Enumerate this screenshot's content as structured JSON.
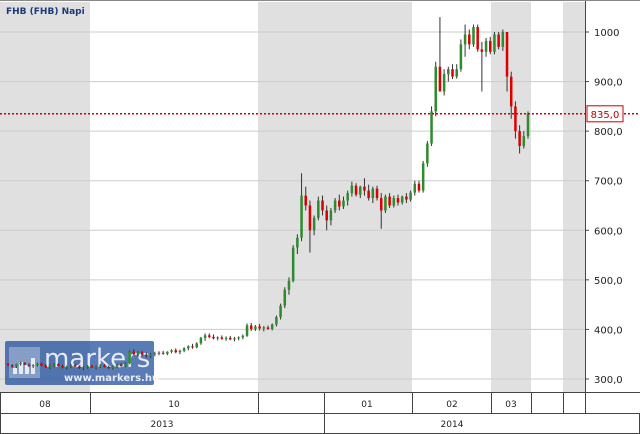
{
  "chart_data": {
    "type": "candlestick",
    "title": "FHB (FHB)  Napi",
    "ylim": [
      270,
      1060
    ],
    "yticks": [
      300,
      400,
      500,
      600,
      700,
      800,
      900,
      1000
    ],
    "ytick_labels": [
      "300,0",
      "400,0",
      "500,0",
      "600,0",
      "700,0",
      "800,0",
      "900,0",
      "1000"
    ],
    "grid": true,
    "last_price": 835,
    "last_price_label": "835,0",
    "colors": {
      "up": "#2e8b2e",
      "down": "#dd0000",
      "wick": "#333333",
      "price_line": "#cc0000",
      "shade": "#e0e0e0",
      "grid": "#cccccc"
    },
    "x_months": [
      "08",
      "10",
      "01",
      "02",
      "03"
    ],
    "x_years": [
      "2013",
      "2014"
    ],
    "watermark": {
      "brand": "markers",
      "url": "www.markers.hu",
      "brand_color": "#1a4a9a"
    },
    "candles": [
      [
        330,
        332,
        326,
        328
      ],
      [
        328,
        330,
        322,
        325
      ],
      [
        325,
        331,
        322,
        330
      ],
      [
        330,
        335,
        327,
        333
      ],
      [
        333,
        334,
        328,
        329
      ],
      [
        329,
        332,
        324,
        326
      ],
      [
        326,
        330,
        322,
        328
      ],
      [
        328,
        333,
        325,
        331
      ],
      [
        331,
        333,
        326,
        327
      ],
      [
        327,
        330,
        322,
        324
      ],
      [
        324,
        329,
        320,
        327
      ],
      [
        327,
        332,
        324,
        330
      ],
      [
        330,
        332,
        325,
        326
      ],
      [
        326,
        329,
        321,
        323
      ],
      [
        323,
        327,
        319,
        325
      ],
      [
        325,
        330,
        322,
        328
      ],
      [
        328,
        331,
        324,
        325
      ],
      [
        325,
        328,
        320,
        322
      ],
      [
        322,
        326,
        318,
        324
      ],
      [
        324,
        328,
        321,
        326
      ],
      [
        326,
        329,
        322,
        323
      ],
      [
        323,
        327,
        319,
        325
      ],
      [
        325,
        330,
        322,
        327
      ],
      [
        327,
        330,
        323,
        324
      ],
      [
        324,
        327,
        320,
        322
      ],
      [
        322,
        327,
        319,
        325
      ],
      [
        325,
        331,
        322,
        329
      ],
      [
        329,
        332,
        325,
        326
      ],
      [
        326,
        334,
        324,
        332
      ],
      [
        332,
        358,
        330,
        355
      ],
      [
        355,
        360,
        348,
        350
      ],
      [
        350,
        356,
        345,
        354
      ],
      [
        354,
        357,
        347,
        349
      ],
      [
        349,
        353,
        343,
        346
      ],
      [
        346,
        352,
        342,
        350
      ],
      [
        350,
        355,
        346,
        352
      ],
      [
        352,
        356,
        348,
        353
      ],
      [
        353,
        357,
        349,
        351
      ],
      [
        351,
        356,
        348,
        355
      ],
      [
        355,
        360,
        352,
        358
      ],
      [
        358,
        362,
        352,
        354
      ],
      [
        354,
        359,
        350,
        357
      ],
      [
        357,
        364,
        354,
        362
      ],
      [
        362,
        368,
        358,
        366
      ],
      [
        366,
        371,
        361,
        364
      ],
      [
        364,
        374,
        362,
        372
      ],
      [
        372,
        385,
        369,
        383
      ],
      [
        383,
        392,
        377,
        388
      ],
      [
        388,
        392,
        382,
        385
      ],
      [
        385,
        390,
        380,
        382
      ],
      [
        382,
        386,
        378,
        384
      ],
      [
        384,
        388,
        379,
        381
      ],
      [
        381,
        386,
        377,
        383
      ],
      [
        383,
        387,
        378,
        380
      ],
      [
        380,
        385,
        376,
        382
      ],
      [
        382,
        386,
        378,
        384
      ],
      [
        384,
        390,
        380,
        387
      ],
      [
        387,
        412,
        385,
        408
      ],
      [
        408,
        413,
        397,
        401
      ],
      [
        401,
        409,
        397,
        406
      ],
      [
        406,
        411,
        398,
        402
      ],
      [
        402,
        407,
        396,
        404
      ],
      [
        404,
        408,
        399,
        401
      ],
      [
        401,
        412,
        398,
        410
      ],
      [
        410,
        428,
        406,
        425
      ],
      [
        425,
        452,
        420,
        448
      ],
      [
        448,
        485,
        443,
        480
      ],
      [
        480,
        505,
        470,
        498
      ],
      [
        498,
        570,
        495,
        565
      ],
      [
        565,
        592,
        552,
        585
      ],
      [
        585,
        715,
        578,
        670
      ],
      [
        670,
        688,
        640,
        650
      ],
      [
        650,
        660,
        555,
        600
      ],
      [
        600,
        630,
        590,
        625
      ],
      [
        625,
        668,
        620,
        660
      ],
      [
        660,
        670,
        630,
        640
      ],
      [
        640,
        650,
        600,
        620
      ],
      [
        620,
        645,
        610,
        640
      ],
      [
        640,
        665,
        635,
        660
      ],
      [
        660,
        672,
        640,
        648
      ],
      [
        648,
        668,
        643,
        660
      ],
      [
        660,
        680,
        650,
        675
      ],
      [
        675,
        698,
        668,
        690
      ],
      [
        690,
        695,
        668,
        672
      ],
      [
        672,
        690,
        665,
        688
      ],
      [
        688,
        705,
        670,
        680
      ],
      [
        680,
        692,
        660,
        665
      ],
      [
        665,
        688,
        655,
        684
      ],
      [
        684,
        690,
        660,
        665
      ],
      [
        665,
        675,
        603,
        640
      ],
      [
        640,
        672,
        635,
        668
      ],
      [
        668,
        675,
        645,
        650
      ],
      [
        650,
        670,
        646,
        665
      ],
      [
        665,
        672,
        650,
        656
      ],
      [
        656,
        670,
        652,
        668
      ],
      [
        668,
        675,
        655,
        662
      ],
      [
        662,
        680,
        658,
        676
      ],
      [
        676,
        700,
        670,
        694
      ],
      [
        694,
        700,
        676,
        680
      ],
      [
        680,
        740,
        676,
        735
      ],
      [
        735,
        780,
        728,
        775
      ],
      [
        775,
        850,
        770,
        840
      ],
      [
        840,
        940,
        830,
        930
      ],
      [
        930,
        1030,
        890,
        880
      ],
      [
        880,
        925,
        872,
        915
      ],
      [
        915,
        930,
        900,
        925
      ],
      [
        925,
        935,
        905,
        910
      ],
      [
        910,
        935,
        906,
        925
      ],
      [
        925,
        985,
        920,
        975
      ],
      [
        975,
        1015,
        950,
        995
      ],
      [
        995,
        1005,
        965,
        975
      ],
      [
        975,
        1015,
        970,
        1010
      ],
      [
        1010,
        1015,
        960,
        965
      ],
      [
        965,
        980,
        880,
        960
      ],
      [
        960,
        988,
        950,
        982
      ],
      [
        982,
        990,
        955,
        960
      ],
      [
        960,
        1000,
        955,
        995
      ],
      [
        995,
        1000,
        965,
        970
      ],
      [
        970,
        1005,
        962,
        1000
      ],
      [
        1000,
        1000,
        880,
        910
      ],
      [
        910,
        920,
        825,
        850
      ],
      [
        850,
        860,
        785,
        800
      ],
      [
        800,
        812,
        755,
        770
      ],
      [
        770,
        800,
        765,
        790
      ],
      [
        790,
        840,
        785,
        835
      ]
    ]
  }
}
